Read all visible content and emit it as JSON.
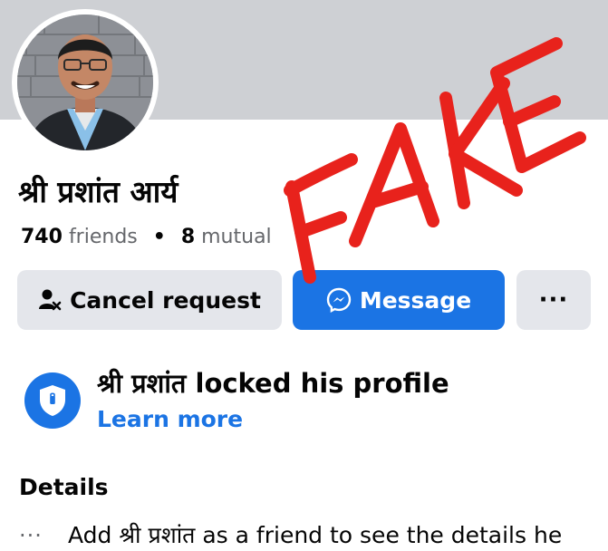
{
  "profile": {
    "name": "श्री प्रशांत आर्य",
    "friends_count": "740",
    "friends_label": "friends",
    "separator": "•",
    "mutual_count": "8",
    "mutual_label": "mutual",
    "avatar_icon": "person-photo"
  },
  "actions": {
    "cancel_request_label": "Cancel request",
    "cancel_request_icon": "person-cancel-icon",
    "message_label": "Message",
    "message_icon": "messenger-icon",
    "more_label": "···"
  },
  "lock_notice": {
    "title": "श्री प्रशांत locked his profile",
    "link_label": "Learn more",
    "icon": "shield-lock-icon"
  },
  "details": {
    "heading": "Details",
    "more_dots": "···",
    "text": "Add श्री प्रशांत as a friend to see the details he"
  },
  "overlay": {
    "stamp_text": "FAKE"
  },
  "colors": {
    "cover": "#ced0d4",
    "accent": "#1b74e4",
    "button_gray": "#e4e6eb",
    "stamp_red": "#e8221c",
    "secondary_text": "#65676b"
  }
}
